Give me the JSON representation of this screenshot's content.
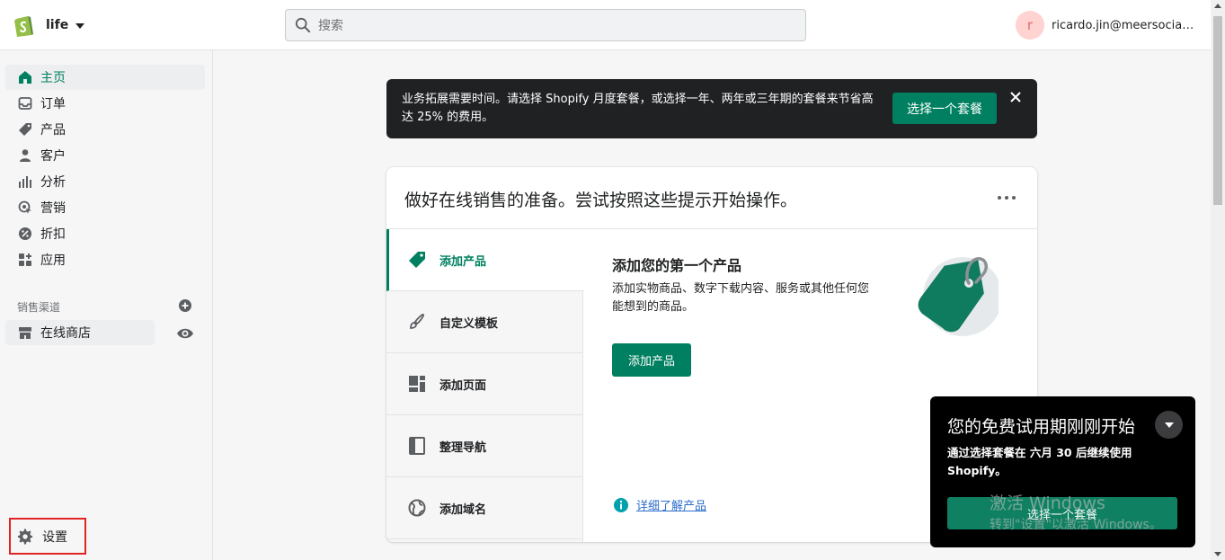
{
  "header": {
    "store_name": "life",
    "search_placeholder": "搜索",
    "user_initial": "r",
    "user_name": "ricardo.jin@meersocial...."
  },
  "sidebar": {
    "items": [
      {
        "label": "主页",
        "icon": "home-icon",
        "active": true
      },
      {
        "label": "订单",
        "icon": "inbox-icon"
      },
      {
        "label": "产品",
        "icon": "tag-icon"
      },
      {
        "label": "客户",
        "icon": "person-icon"
      },
      {
        "label": "分析",
        "icon": "bar-chart-icon"
      },
      {
        "label": "营销",
        "icon": "target-icon"
      },
      {
        "label": "折扣",
        "icon": "discount-icon"
      },
      {
        "label": "应用",
        "icon": "apps-icon"
      }
    ],
    "channels_heading": "销售渠道",
    "online_store": "在线商店",
    "settings": "设置"
  },
  "banner": {
    "text": "业务拓展需要时间。请选择 Shopify 月度套餐，或选择一年、两年或三年期的套餐来节省高达 25% 的费用。",
    "button": "选择一个套餐"
  },
  "setup_card": {
    "title": "做好在线销售的准备。尝试按照这些提示开始操作。",
    "steps": [
      {
        "label": "添加产品",
        "icon": "tag-icon",
        "active": true
      },
      {
        "label": "自定义模板",
        "icon": "brush-icon"
      },
      {
        "label": "添加页面",
        "icon": "page-layout-icon"
      },
      {
        "label": "整理导航",
        "icon": "navigation-icon"
      },
      {
        "label": "添加域名",
        "icon": "globe-icon"
      }
    ],
    "detail_title": "添加您的第一个产品",
    "detail_desc": "添加实物商品、数字下载内容、服务或其他任何您能想到的商品。",
    "detail_button": "添加产品",
    "learn_more": "详细了解产品"
  },
  "toast": {
    "title": "您的免费试用期刚刚开始",
    "body": "通过选择套餐在 六月 30 后继续使用 Shopify。",
    "button": "选择一个套餐"
  },
  "watermark": {
    "line1": "激活 Windows",
    "line2": "转到\"设置\"以激活 Windows。"
  },
  "colors": {
    "accent": "#008060",
    "banner_bg": "#202123",
    "toast_bg": "#000000",
    "highlight": "#e02424"
  }
}
